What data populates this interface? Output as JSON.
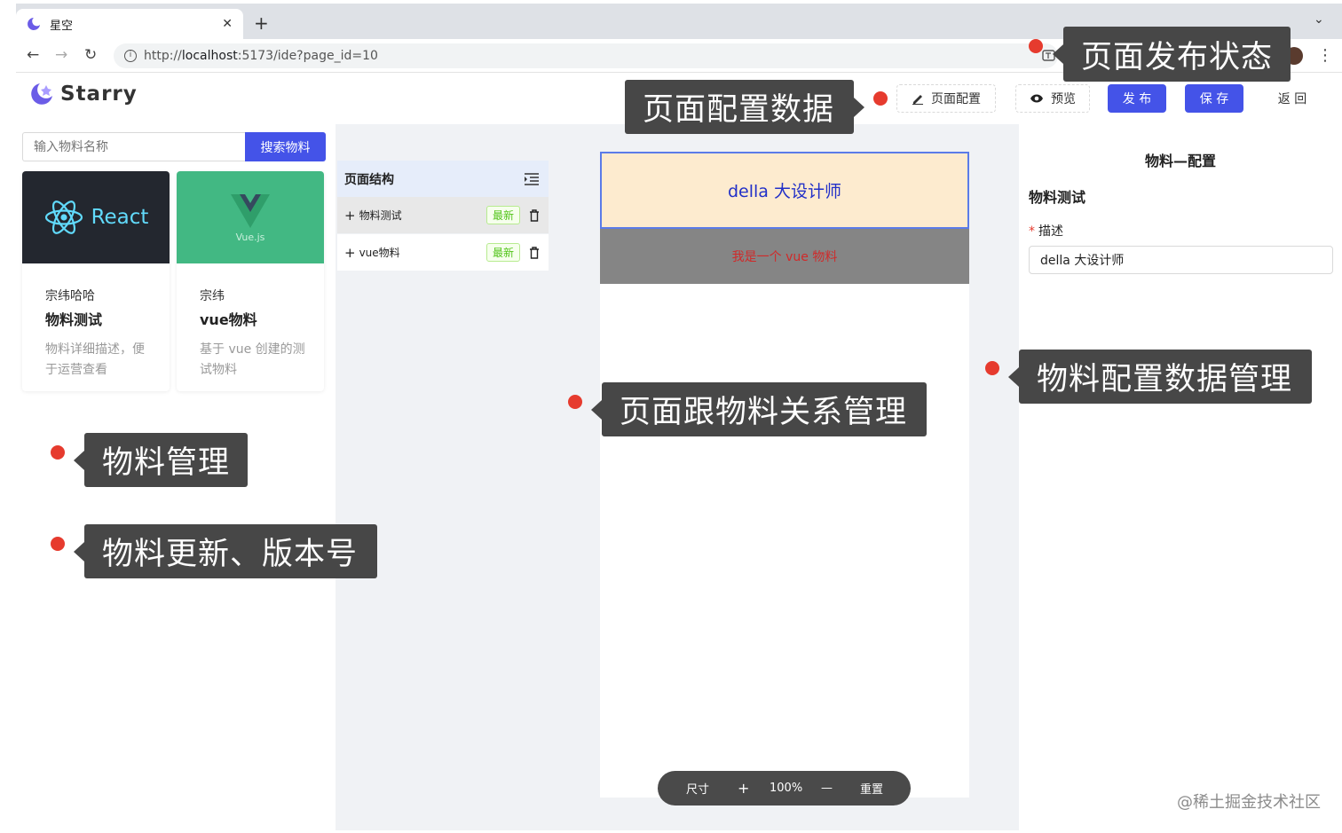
{
  "browser": {
    "tab_title": "星空",
    "url_prefix": "http://",
    "url_host": "localhost",
    "url_rest": ":5173/ide?page_id=10"
  },
  "app": {
    "logo_text": "Starry",
    "buttons": {
      "page_config": "页面配置",
      "preview": "预览",
      "publish": "发 布",
      "save": "保 存",
      "back": "返 回"
    }
  },
  "materials": {
    "search_placeholder": "输入物料名称",
    "search_button": "搜索物料",
    "cards": [
      {
        "cover_text": "React",
        "author": "宗纬哈哈",
        "name": "物料测试",
        "desc": "物料详细描述，便于运营查看",
        "cover_color": "#23272f"
      },
      {
        "cover_text": "Vue.js",
        "author": "宗纬",
        "name": "vue物料",
        "desc": "基于 vue 创建的测试物料",
        "cover_color": "#42b883"
      }
    ]
  },
  "structure": {
    "title": "页面结构",
    "rows": [
      {
        "label": "物料测试",
        "badge": "最新"
      },
      {
        "label": "vue物料",
        "badge": "最新"
      }
    ]
  },
  "canvas": {
    "react_text": "della 大设计师",
    "vue_text": "我是一个 vue 物料",
    "zoom": {
      "size_label": "尺寸",
      "plus": "+",
      "value": "100%",
      "minus": "—",
      "reset": "重置"
    }
  },
  "config": {
    "title": "物料—配置",
    "subtitle": "物料测试",
    "required_mark": "*",
    "field_label": "描述",
    "field_value": "della 大设计师"
  },
  "annotations": {
    "publish_status": "页面发布状态",
    "page_config_data": "页面配置数据",
    "material_config_mgmt": "物料配置数据管理",
    "page_material_relation": "页面跟物料关系管理",
    "material_mgmt": "物料管理",
    "material_update": "物料更新、版本号"
  },
  "watermark": "@稀土掘金技术社区",
  "colors": {
    "primary": "#4453e8",
    "annotation_dot": "#e63b2e",
    "annotation_bg": "#474747"
  }
}
